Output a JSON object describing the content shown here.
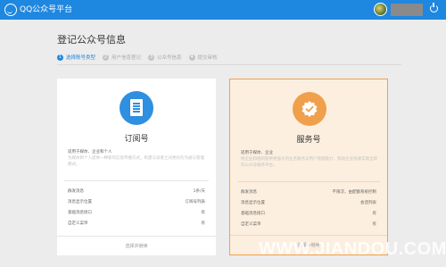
{
  "header": {
    "brand": "QQ公众号平台",
    "icons": [
      "qq-logo-icon",
      "avatar",
      "power-icon"
    ]
  },
  "page": {
    "title": "登记公众号信息",
    "steps": [
      {
        "num": "1",
        "label": "选择账号类型"
      },
      {
        "num": "2",
        "label": "用户信息登记"
      },
      {
        "num": "3",
        "label": "公众号信息"
      },
      {
        "num": "4",
        "label": "提交审核"
      }
    ]
  },
  "cards": {
    "subscription": {
      "name": "订阅号",
      "audience": "适用于媒体、企业和个人",
      "desc": "为媒体和个人提供一种新的信息传播方式，构建与读者之间更好的沟通与管理模式。",
      "features": [
        {
          "label": "群发消息",
          "value": "1条/天"
        },
        {
          "label": "消息显示位置",
          "value": "订阅号列表"
        },
        {
          "label": "基础消息接口",
          "value": "有"
        },
        {
          "label": "自定义菜单",
          "value": "有"
        }
      ],
      "button": "选择并继续"
    },
    "service": {
      "name": "服务号",
      "audience": "适用于媒体、企业",
      "desc": "给企业和组织提供更强大的业务服务与用户管理能力，帮助企业快速实现全新的公众号服务平台。",
      "features": [
        {
          "label": "群发消息",
          "value": "不限次，由配额系统控制"
        },
        {
          "label": "消息显示位置",
          "value": "会话列表"
        },
        {
          "label": "基础消息接口",
          "value": "有"
        },
        {
          "label": "自定义菜单",
          "value": "有"
        }
      ],
      "button": "选择并继续"
    }
  },
  "watermark": "WWW.JIANDOU.COM",
  "colors": {
    "topbar": "#1e87e0",
    "subscription_icon": "#2f8fe0",
    "service_icon": "#f0a04b",
    "service_bg": "#fcefdf"
  }
}
